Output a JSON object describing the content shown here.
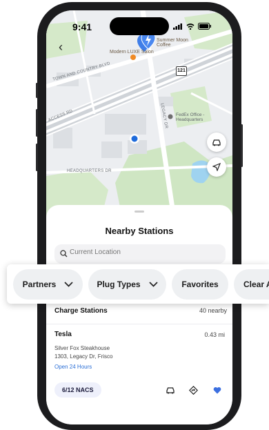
{
  "status_bar": {
    "time": "9:41"
  },
  "map": {
    "pois": [
      {
        "name": "Modern LUXE Salon"
      },
      {
        "name": "Summer Moon Coffee"
      },
      {
        "name": "FedEx Office - Headquarters"
      }
    ],
    "roads": [
      "TOWN AND COUNTRY BLVD",
      "ACCESS RD",
      "LEGACY DR",
      "HEADQUARTERS DR"
    ],
    "highway_shield": "121",
    "buttons": {
      "car_icon": "car-icon",
      "locate_icon": "navigation-arrow-icon"
    }
  },
  "sheet": {
    "title": "Nearby Stations",
    "search": {
      "placeholder": "Current Location",
      "value": ""
    },
    "section": {
      "title": "Charge Stations",
      "count": "40 nearby"
    },
    "station": {
      "name": "Tesla",
      "distance": "0.43 mi",
      "address_line1": "Silver Fox Steakhouse",
      "address_line2": "1303, Legacy Dr, Frisco",
      "hours": "Open 24 Hours",
      "availability": "6/12 NACS",
      "favorite_color": "#3b6fe0"
    }
  },
  "filters": [
    {
      "label": "Partners",
      "has_dropdown": true
    },
    {
      "label": "Plug Types",
      "has_dropdown": true
    },
    {
      "label": "Favorites",
      "has_dropdown": false
    },
    {
      "label": "Clear A",
      "has_dropdown": false
    }
  ],
  "colors": {
    "accent": "#2b6fd6",
    "location_dot": "#1e6bdb",
    "pin": "#3f7ee8",
    "park": "#cfe6c3"
  }
}
